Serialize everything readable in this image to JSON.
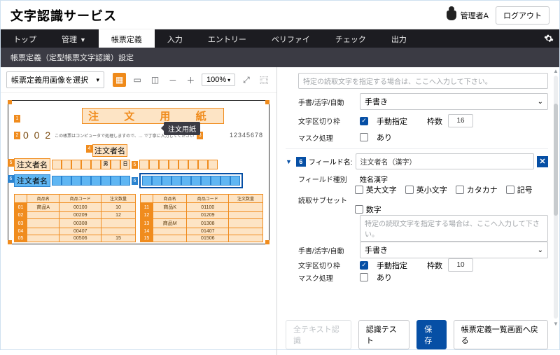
{
  "header": {
    "title": "文字認識サービス",
    "user": "管理者A",
    "logout": "ログアウト"
  },
  "nav": {
    "items": [
      "トップ",
      "管理",
      "帳票定義",
      "入力",
      "エントリー",
      "ベリファイ",
      "チェック",
      "出力"
    ],
    "active_index": 2,
    "dropdown_index": 1
  },
  "subnav": {
    "text": "帳票定義（定型帳票文字認識）設定"
  },
  "left": {
    "select_label": "帳票定義用画像を選択",
    "zoom": "100%",
    "preview": {
      "title": "注 文 用 紙",
      "tooltip": "注文用紙",
      "doc_no": "0 0 2",
      "top_right_number": "12345678",
      "note": "この帳票はコンピュータで処理しますので、… で丁寧に入力してください",
      "box_group_label": "注文者名",
      "row1_label": "注文者名",
      "row1_tag1": "男",
      "row1_tag2": "日",
      "row2_label": "注文者名",
      "tag_nums": {
        "t1": "1",
        "t2": "2",
        "t3": "3",
        "t4": "4",
        "t5": "5",
        "t6": "6"
      },
      "table": {
        "headers": [
          "商品名",
          "商品コード",
          "注文数量",
          "",
          "商品名",
          "商品コード",
          "注文数量"
        ],
        "rows": [
          [
            "01",
            "商品A",
            "00100",
            "10",
            "11",
            "商品K",
            "01100"
          ],
          [
            "02",
            "",
            "00209",
            "12",
            "12",
            "",
            "01209"
          ],
          [
            "03",
            "",
            "00308",
            "",
            "13",
            "商品M",
            "01308"
          ],
          [
            "04",
            "",
            "00407",
            "",
            "14",
            "",
            "01407"
          ],
          [
            "05",
            "",
            "00506",
            "15",
            "15",
            "",
            "01506"
          ]
        ]
      }
    }
  },
  "right": {
    "placeholder_text": "特定の読取文字を指定する場合は、ここへ入力して下さい。",
    "sec1": {
      "labels": {
        "hand": "手書/活字/自動",
        "split": "文字区切り枠",
        "mask": "マスク処理"
      },
      "hand_select": "手書き",
      "split_checked": true,
      "split_label": "手動指定",
      "wakusu_label": "枠数",
      "wakusu_value": "16",
      "mask_label": "あり"
    },
    "sec2": {
      "badge": "6",
      "field_name_label": "フィールド名:",
      "field_name_value": "注文者名（漢字）",
      "field_type_label": "フィールド種別",
      "field_type_value": "姓名漢字",
      "subset_label": "読取サブセット",
      "subset_note_placeholder": "特定の読取文字を指定する場合は、ここへ入力して下さい。",
      "subset_opts": [
        "英大文字",
        "英小文字",
        "カタカナ",
        "記号",
        "数字"
      ],
      "hand_label": "手書/活字/自動",
      "hand_value": "手書き",
      "split_label": "文字区切り枠",
      "split_checked": true,
      "split_manual": "手動指定",
      "wakusu_label": "枠数",
      "wakusu_value": "10",
      "mask_label": "マスク処理",
      "mask_opt": "あり"
    },
    "footer": {
      "b1": "全テキスト認識",
      "b2": "認識テスト",
      "b3": "保存",
      "b4": "帳票定義一覧画面へ戻る"
    }
  }
}
